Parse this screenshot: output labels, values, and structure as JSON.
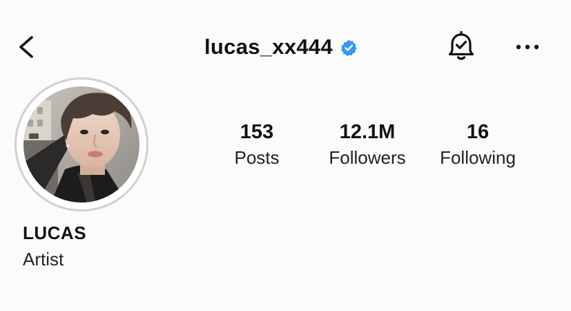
{
  "header": {
    "username": "lucas_xx444",
    "verified": true,
    "accent_color": "#3897f0"
  },
  "icons": {
    "back": "chevron-left-icon",
    "verified": "verified-badge-icon",
    "notifications": "bell-check-icon",
    "more": "more-horizontal-icon"
  },
  "profile": {
    "display_name": "LUCAS",
    "category": "Artist"
  },
  "stats": {
    "posts": {
      "value": "153",
      "label": "Posts"
    },
    "followers": {
      "value": "12.1M",
      "label": "Followers"
    },
    "following": {
      "value": "16",
      "label": "Following"
    }
  }
}
